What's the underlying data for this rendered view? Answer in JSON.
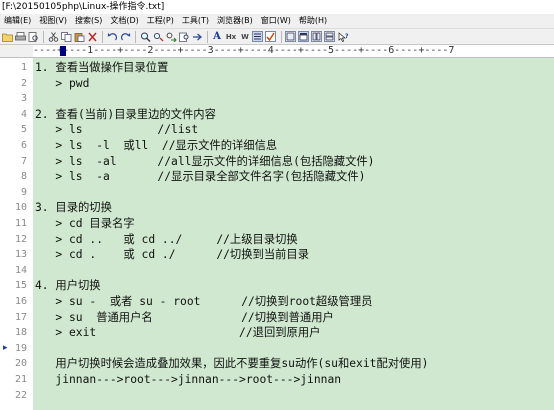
{
  "window": {
    "title": "[F:\\20150105php\\Linux-操作指令.txt]"
  },
  "menu": [
    "编辑(E)",
    "视图(V)",
    "搜索(S)",
    "文档(D)",
    "工程(P)",
    "工具(T)",
    "浏览器(B)",
    "窗口(W)",
    "帮助(H)"
  ],
  "toolbar": {
    "icons": [
      "open-folder-icon",
      "print-icon",
      "print-preview-icon",
      "cut-icon",
      "copy-icon",
      "paste-icon",
      "delete-icon",
      "undo-icon",
      "redo-icon",
      "find-icon",
      "find-next-icon",
      "replace-icon",
      "find-in-files-icon",
      "goto-icon",
      "font-icon",
      "hex-icon",
      "word-wrap-icon",
      "column-mode-icon",
      "spell-check-icon",
      "window-1-icon",
      "window-2-icon",
      "window-3-icon",
      "window-4-icon",
      "help-icon"
    ],
    "font_glyph": "A",
    "hex_label": "Hx",
    "wrap_label": "W"
  },
  "ruler": {
    "text": "----+----1----+----2----+----3----+----4----+----5----+----6----+----7"
  },
  "editor": {
    "lines": [
      {
        "n": "1",
        "text": "1. 查看当做操作目录位置"
      },
      {
        "n": "2",
        "text": "   > pwd"
      },
      {
        "n": "3",
        "text": ""
      },
      {
        "n": "4",
        "text": "2. 查看(当前)目录里边的文件内容"
      },
      {
        "n": "5",
        "text": "   > ls           //list"
      },
      {
        "n": "6",
        "text": "   > ls  -l  或ll  //显示文件的详细信息"
      },
      {
        "n": "7",
        "text": "   > ls  -al      //all显示文件的详细信息(包括隐藏文件)"
      },
      {
        "n": "8",
        "text": "   > ls  -a       //显示目录全部文件名字(包括隐藏文件)"
      },
      {
        "n": "9",
        "text": ""
      },
      {
        "n": "10",
        "text": "3. 目录的切换"
      },
      {
        "n": "11",
        "text": "   > cd 目录名字"
      },
      {
        "n": "12",
        "text": "   > cd ..   或 cd ../     //上级目录切换"
      },
      {
        "n": "13",
        "text": "   > cd .    或 cd ./      //切换到当前目录"
      },
      {
        "n": "14",
        "text": ""
      },
      {
        "n": "15",
        "text": "4. 用户切换"
      },
      {
        "n": "16",
        "text": "   > su -  或者 su - root      //切换到root超级管理员"
      },
      {
        "n": "17",
        "text": "   > su  普通用户名             //切换到普通用户"
      },
      {
        "n": "18",
        "text": "   > exit                     //退回到原用户"
      },
      {
        "n": "19",
        "text": ""
      },
      {
        "n": "20",
        "text": "   用户切换时候会造成叠加效果，因此不要重复su动作(su和exit配对使用)"
      },
      {
        "n": "21",
        "text": "   jinnan--->root--->jinnan--->root--->jinnan"
      },
      {
        "n": "22",
        "text": ""
      }
    ],
    "current_line": "19",
    "colors": {
      "background": "#cfe8cf",
      "text": "#111111",
      "line_numbers": "#8a8a8a"
    }
  }
}
